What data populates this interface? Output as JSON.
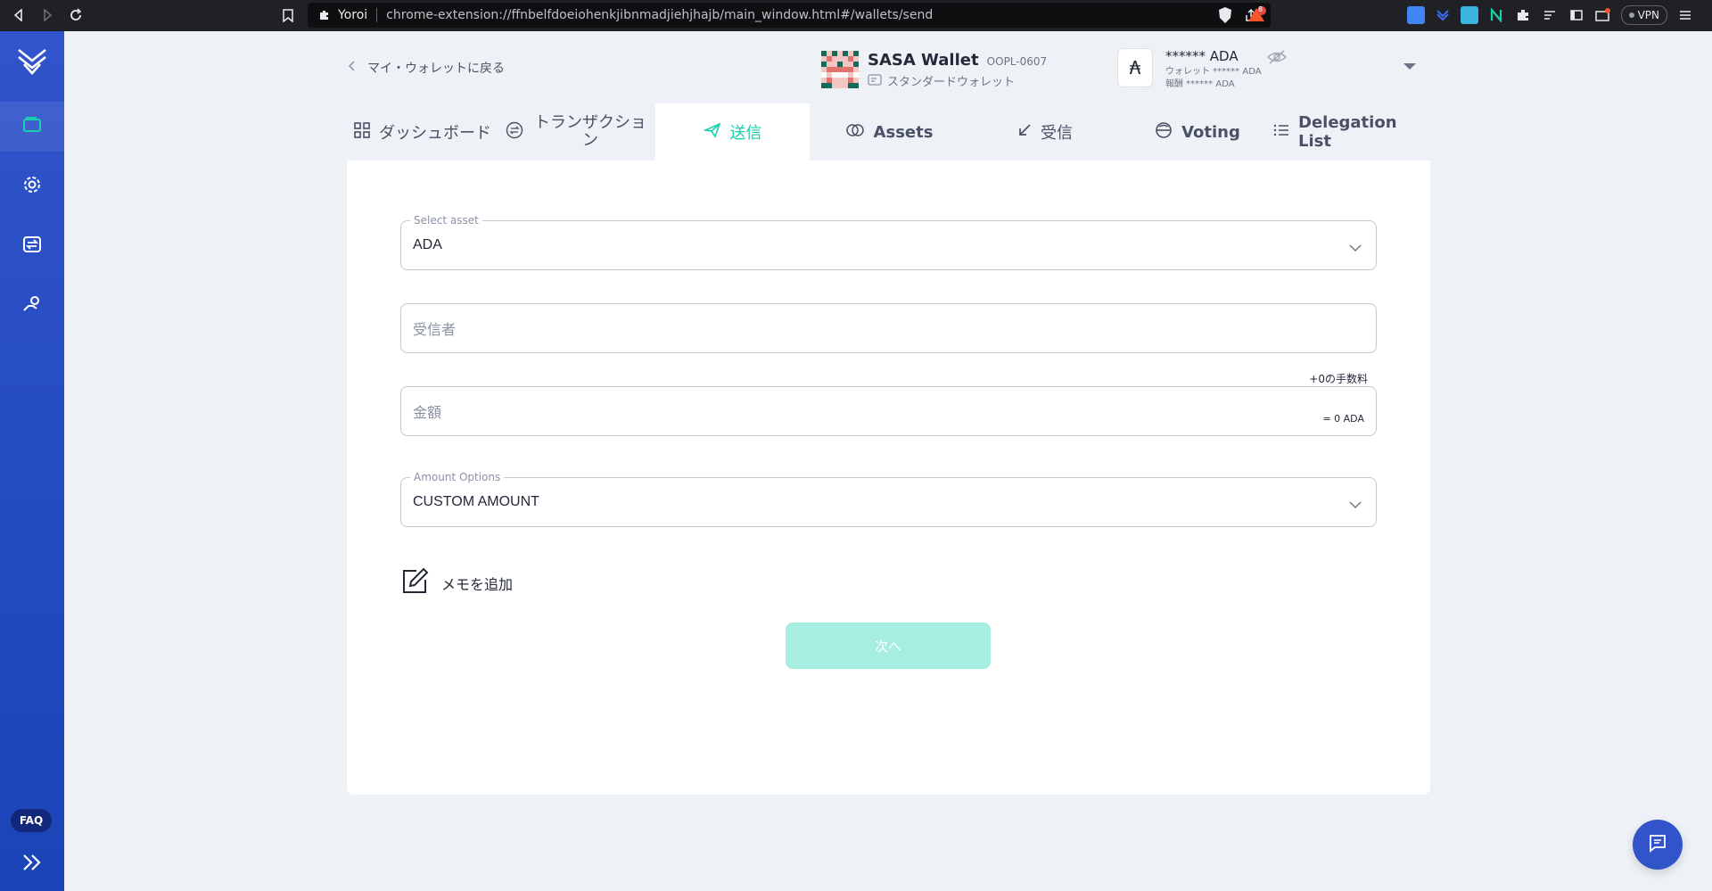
{
  "browser": {
    "site_name": "Yoroi",
    "url": "chrome-extension://ffnbelfdoeiohenkjibnmadjiehjhajb/main_window.html#/wallets/send",
    "vpn_label": "VPN",
    "badge_count": "8"
  },
  "sidebar": {
    "faq_label": "FAQ"
  },
  "header": {
    "back_label": "マイ・ウォレットに戻る",
    "wallet_name": "SASA Wallet",
    "wallet_plate": "OOPL-0607",
    "wallet_type": "スタンダードウォレット",
    "balance_main": "****** ADA",
    "balance_wallet": "ウォレット ****** ADA",
    "balance_reward": "報酬 ****** ADA",
    "ada_symbol": "₳"
  },
  "tabs": [
    {
      "label": "ダッシュボード"
    },
    {
      "label": "トランザクション"
    },
    {
      "label": "送信"
    },
    {
      "label": "Assets"
    },
    {
      "label": "受信"
    },
    {
      "label": "Voting"
    },
    {
      "label": "Delegation List"
    }
  ],
  "form": {
    "select_asset_label": "Select asset",
    "select_asset_value": "ADA",
    "receiver_placeholder": "受信者",
    "fee_label": "+0の手数料",
    "amount_placeholder": "金額",
    "amount_equiv": "= 0 ADA",
    "amount_options_label": "Amount Options",
    "amount_options_value": "CUSTOM AMOUNT",
    "memo_label": "メモを追加",
    "next_label": "次へ"
  },
  "colors": {
    "accent": "#17d1aa",
    "sidebar": "#3154cb",
    "next_disabled": "#a6eedf"
  }
}
